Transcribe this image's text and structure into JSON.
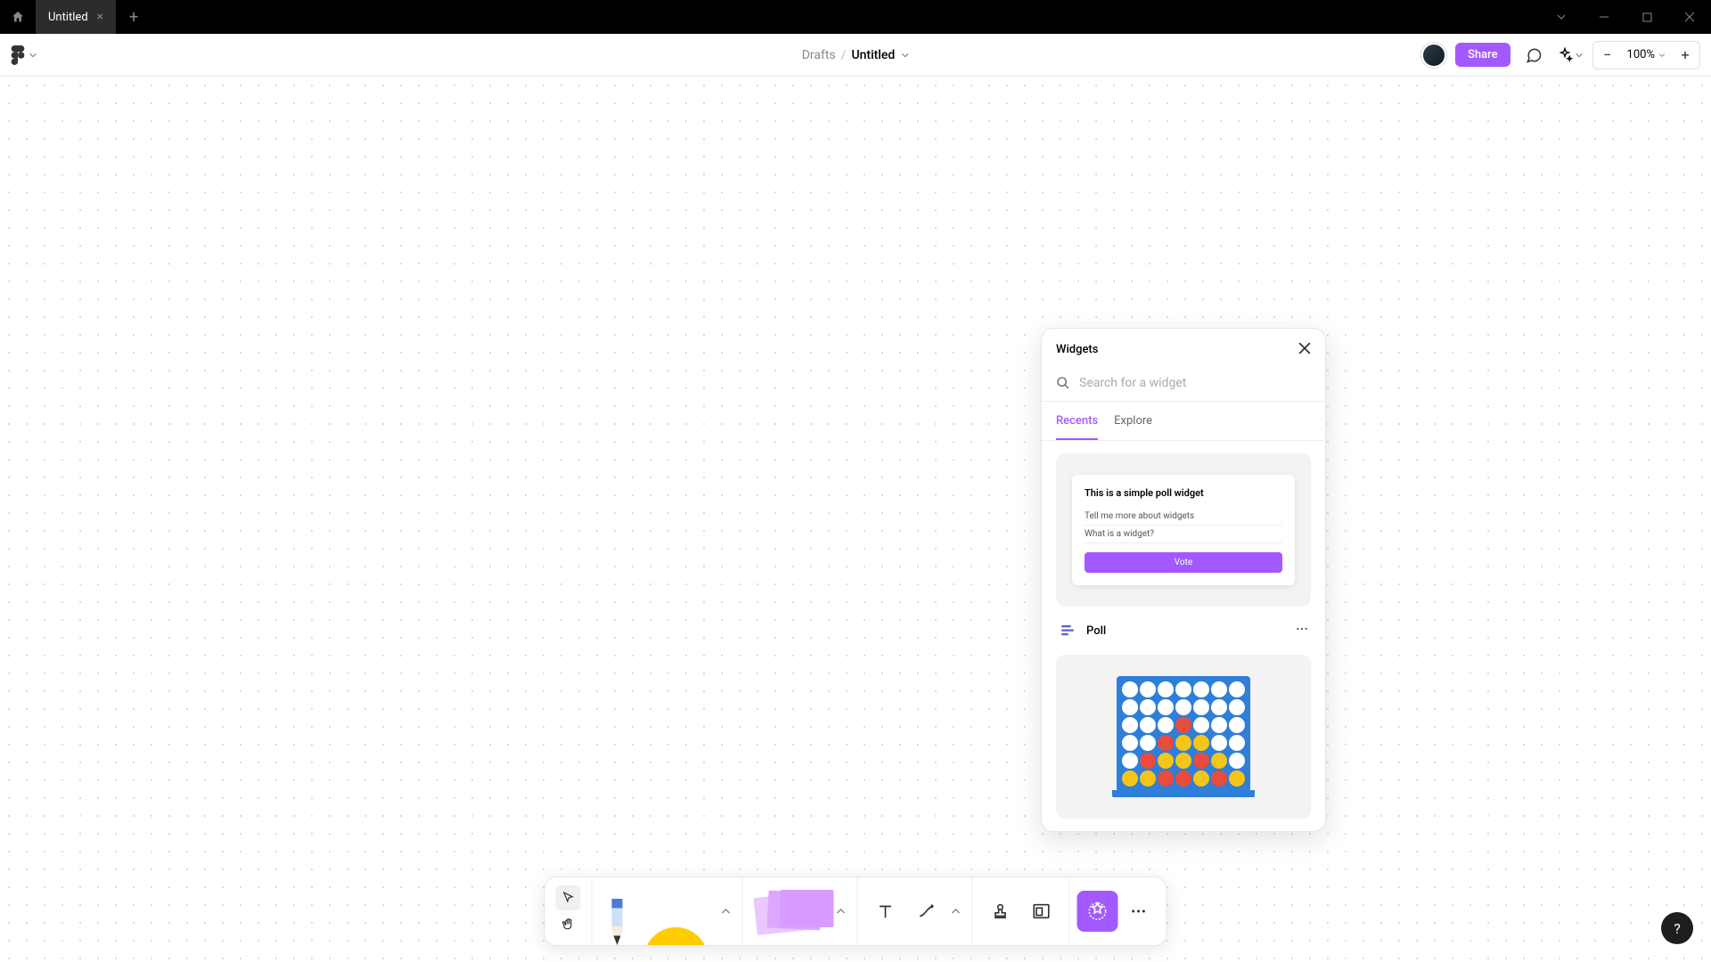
{
  "titlebar": {
    "tab_name": "Untitled"
  },
  "header": {
    "breadcrumb_folder": "Drafts",
    "breadcrumb_file": "Untitled",
    "share_label": "Share",
    "zoom": "100%"
  },
  "widgets_panel": {
    "title": "Widgets",
    "search_placeholder": "Search for a widget",
    "tabs": {
      "recents": "Recents",
      "explore": "Explore"
    },
    "items": [
      {
        "name": "Poll",
        "preview": {
          "title": "This is a simple poll widget",
          "options": [
            "Tell me more about widgets",
            "What is a widget?"
          ],
          "vote_label": "Vote"
        }
      }
    ]
  },
  "help_label": "?"
}
